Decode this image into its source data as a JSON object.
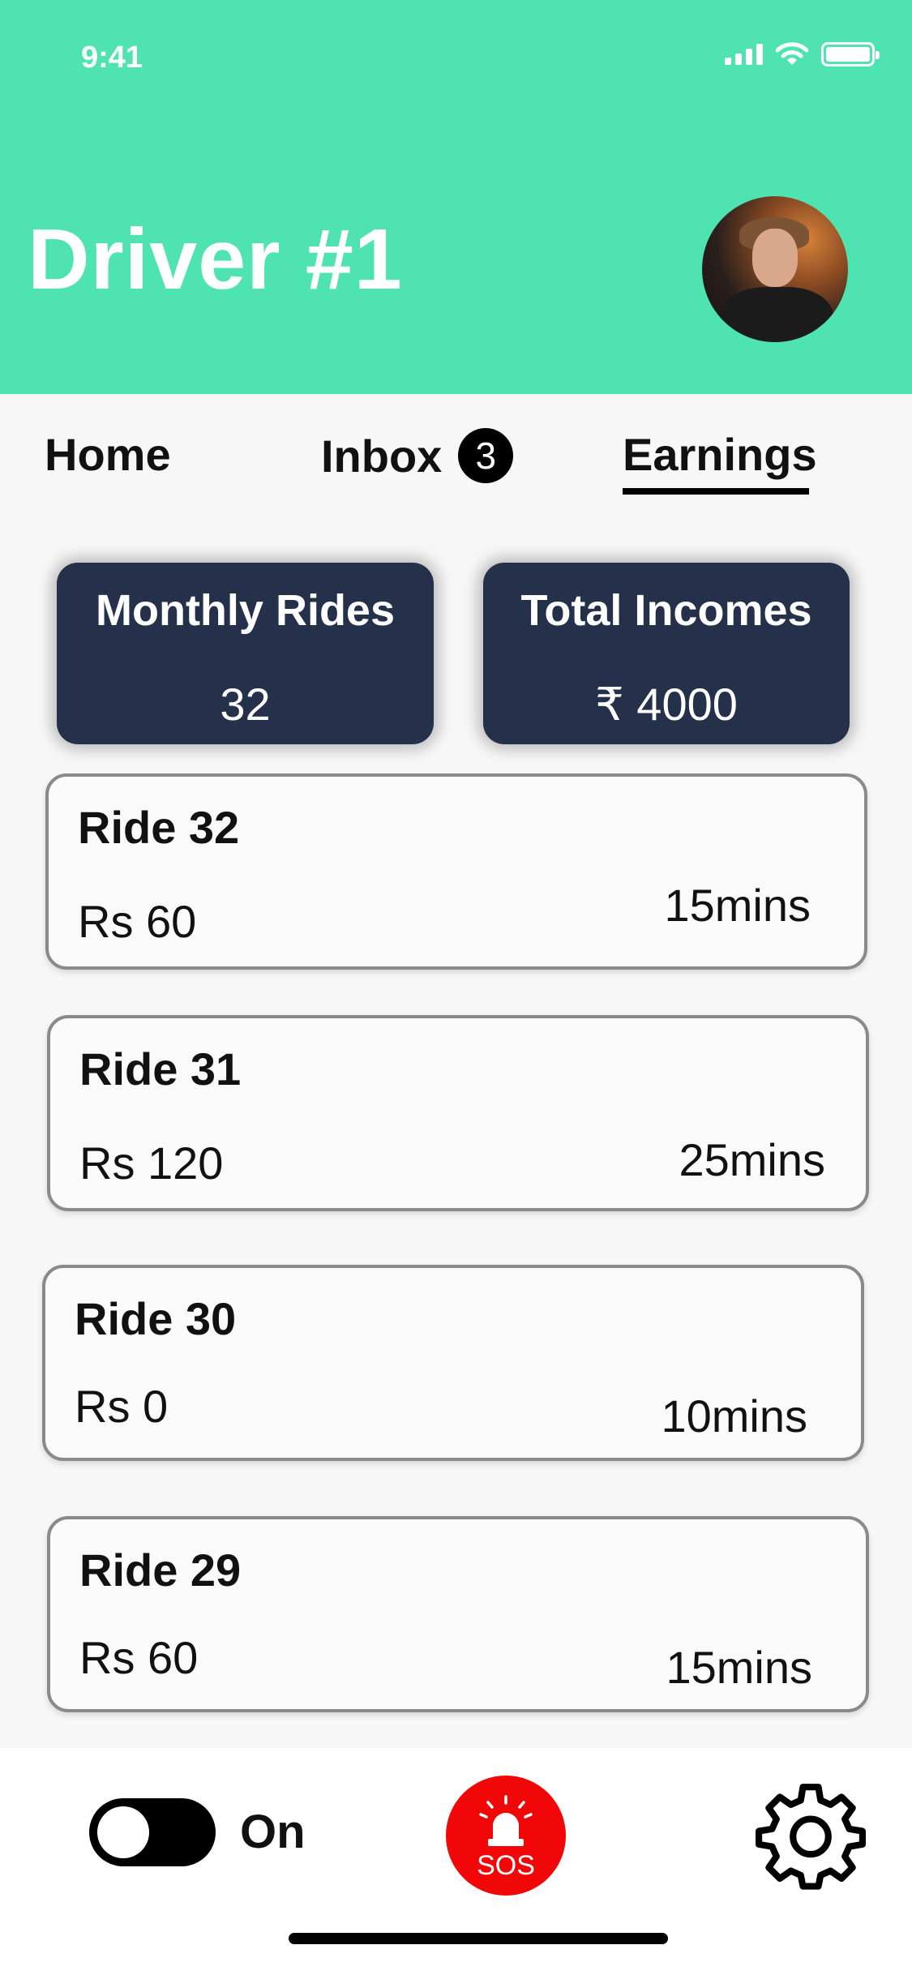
{
  "status_bar": {
    "time": "9:41"
  },
  "header": {
    "title": "Driver #1",
    "background_color": "#4fe3b1"
  },
  "tabs": [
    {
      "label": "Home",
      "active": false
    },
    {
      "label": "Inbox",
      "badge": "3",
      "active": false
    },
    {
      "label": "Earnings",
      "active": true
    }
  ],
  "stats": {
    "monthly_rides_label": "Monthly Rides",
    "monthly_rides_value": "32",
    "total_incomes_label": "Total Incomes",
    "total_incomes_value": "₹ 4000"
  },
  "rides": [
    {
      "title": "Ride 32",
      "amount": "Rs 60",
      "duration": "15mins"
    },
    {
      "title": "Ride 31",
      "amount": "Rs 120",
      "duration": "25mins"
    },
    {
      "title": "Ride 30",
      "amount": "Rs 0",
      "duration": "10mins"
    },
    {
      "title": "Ride 29",
      "amount": "Rs 60",
      "duration": "15mins"
    }
  ],
  "bottom_bar": {
    "toggle_label": "On",
    "toggle_on": true,
    "sos_label": "SOS",
    "sos_color": "#f10707",
    "settings_icon": "gear-icon"
  },
  "colors": {
    "accent": "#4fe3b1",
    "card_dark": "#25304a"
  }
}
